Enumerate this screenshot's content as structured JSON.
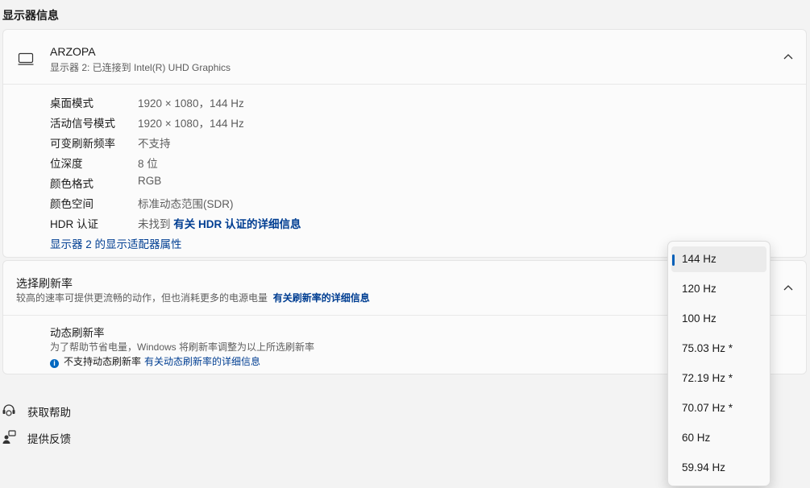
{
  "section_title": "显示器信息",
  "display": {
    "name": "ARZOPA",
    "subtitle": "显示器 2: 已连接到 Intel(R) UHD Graphics",
    "rows": [
      {
        "label": "桌面模式",
        "value": "1920 × 1080，144 Hz"
      },
      {
        "label": "活动信号模式",
        "value": "1920 × 1080，144 Hz"
      },
      {
        "label": "可变刷新频率",
        "value": "不支持"
      },
      {
        "label": "位深度",
        "value": "8 位"
      },
      {
        "label": "颜色格式",
        "value": "RGB"
      },
      {
        "label": "颜色空间",
        "value": "标准动态范围(SDR)"
      },
      {
        "label": "HDR 认证",
        "value": "未找到",
        "link": "有关 HDR 认证的详细信息"
      }
    ],
    "adapter_link": "显示器 2 的显示适配器属性"
  },
  "refresh": {
    "title": "选择刷新率",
    "subtitle": "较高的速率可提供更流畅的动作，但也消耗更多的电源电量",
    "subtitle_link": "有关刷新率的详细信息",
    "dynamic_title": "动态刷新率",
    "dynamic_sub": "为了帮助节省电量，Windows 将刷新率调整为以上所选刷新率",
    "dynamic_note": "不支持动态刷新率",
    "dynamic_link": "有关动态刷新率的详细信息",
    "options": [
      "144 Hz",
      "120 Hz",
      "100 Hz",
      "75.03 Hz *",
      "72.19 Hz *",
      "70.07 Hz *",
      "60 Hz",
      "59.94 Hz"
    ],
    "selected": "144 Hz"
  },
  "help": {
    "get_help": "获取帮助",
    "feedback": "提供反馈"
  },
  "colors": {
    "accent": "#005fb8",
    "link": "#003e92"
  },
  "icons": [
    "monitor-icon",
    "chevron-up-icon",
    "info-icon",
    "help-icon",
    "feedback-icon"
  ]
}
